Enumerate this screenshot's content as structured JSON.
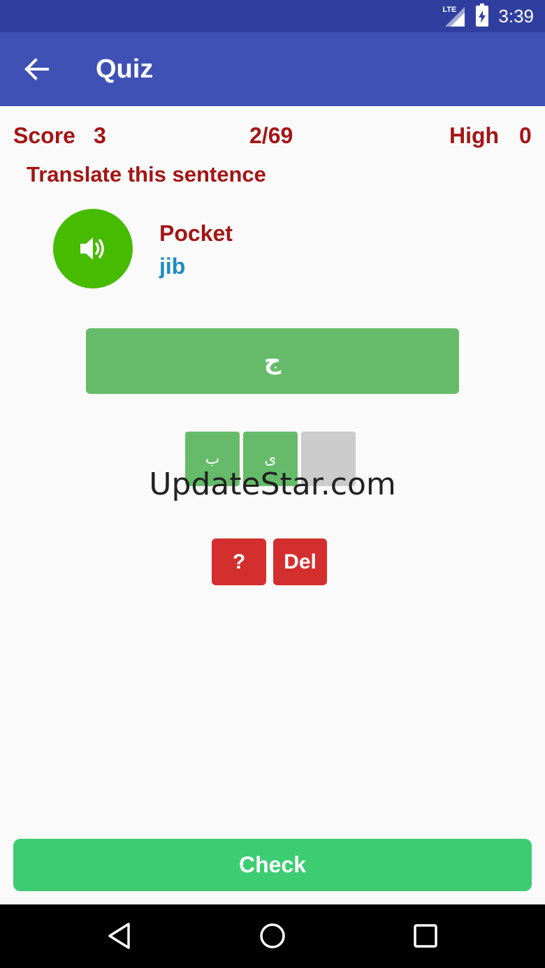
{
  "status_bar": {
    "network": "LTE",
    "time": "3:39"
  },
  "app_bar": {
    "back_icon": "arrow-left-icon",
    "title": "Quiz"
  },
  "score_row": {
    "score_label": "Score",
    "score_value": "3",
    "progress": "2/69",
    "high_label": "High",
    "high_value": "0"
  },
  "instruction": "Translate this sentence",
  "prompt": {
    "speaker_icon": "speaker-icon",
    "word": "Pocket",
    "transliteration": "jib"
  },
  "answer": {
    "text": "ج"
  },
  "letter_tiles": [
    "ب",
    "ی",
    ""
  ],
  "watermark": "UpdateStar.com",
  "actions": {
    "hint_label": "?",
    "delete_label": "Del"
  },
  "check_label": "Check",
  "nav": {
    "back_icon": "triangle-back-icon",
    "home_icon": "circle-home-icon",
    "recents_icon": "square-recents-icon"
  },
  "colors": {
    "status_bar": "#303f9f",
    "app_bar": "#3f51b5",
    "accent_red": "#a31515",
    "speaker_green": "#47bb00",
    "tile_green": "#66bb6a",
    "button_red": "#d32f2f",
    "check_green": "#3dcc72",
    "translit_blue": "#1e8bc3"
  }
}
